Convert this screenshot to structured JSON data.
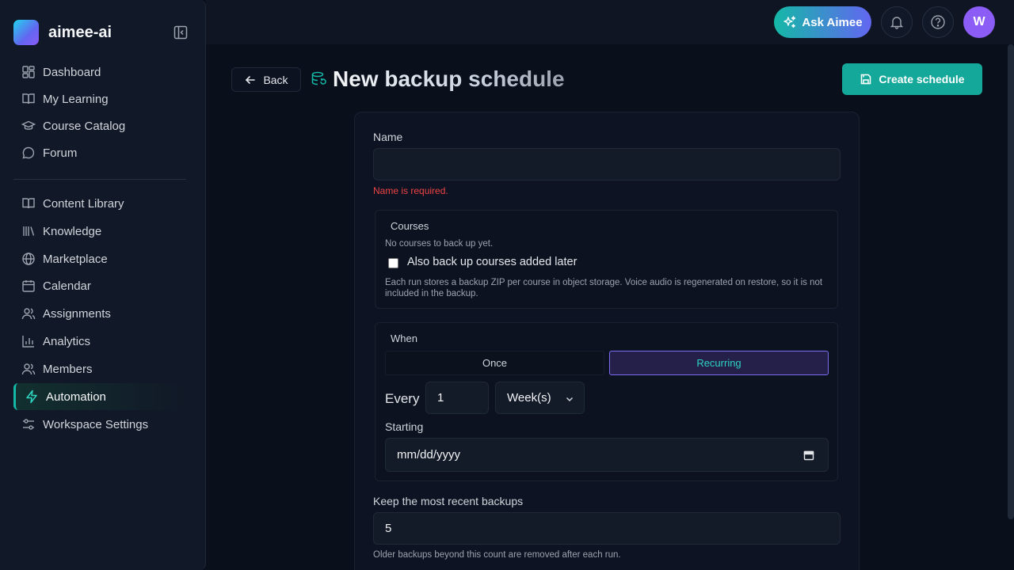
{
  "brand": {
    "name": "aimee-ai"
  },
  "sidebar": {
    "primary": [
      {
        "label": "Dashboard",
        "icon": "dashboard-icon"
      },
      {
        "label": "My Learning",
        "icon": "book-open-icon"
      },
      {
        "label": "Course Catalog",
        "icon": "graduation-cap-icon"
      },
      {
        "label": "Forum",
        "icon": "chat-bubble-icon"
      }
    ],
    "secondary": [
      {
        "label": "Content Library",
        "icon": "book-open-icon"
      },
      {
        "label": "Knowledge",
        "icon": "library-icon"
      },
      {
        "label": "Marketplace",
        "icon": "globe-icon"
      },
      {
        "label": "Calendar",
        "icon": "calendar-icon"
      },
      {
        "label": "Assignments",
        "icon": "users-icon"
      },
      {
        "label": "Analytics",
        "icon": "bar-chart-icon"
      },
      {
        "label": "Members",
        "icon": "users-icon"
      },
      {
        "label": "Automation",
        "icon": "lightning-icon",
        "active": true
      },
      {
        "label": "Workspace Settings",
        "icon": "sliders-icon"
      }
    ]
  },
  "topbar": {
    "ask_label": "Ask Aimee",
    "avatar_initial": "W"
  },
  "header": {
    "back_label": "Back",
    "title": "New backup schedule",
    "create_label": "Create schedule"
  },
  "form": {
    "name_label": "Name",
    "name_value": "",
    "name_error": "Name is required.",
    "courses": {
      "legend": "Courses",
      "empty_text": "No courses to back up yet.",
      "checkbox_label": "Also back up courses added later",
      "checkbox_checked": false,
      "help_text": "Each run stores a backup ZIP per course in object storage. Voice audio is regenerated on restore, so it is not included in the backup."
    },
    "when": {
      "legend": "When",
      "options": [
        "Once",
        "Recurring"
      ],
      "selected": "Recurring",
      "every_label": "Every",
      "every_value": "1",
      "unit_value": "Week(s)",
      "starting_label": "Starting",
      "date_placeholder": "mm/dd/yyyy"
    },
    "keep_label": "Keep the most recent backups",
    "keep_value": "5",
    "keep_help": "Older backups beyond this count are removed after each run."
  },
  "colors": {
    "accent": "#14b8a6",
    "brand_gradient_start": "#14b8a6",
    "brand_gradient_end": "#6366f1",
    "avatar": "#8b5cf6",
    "error": "#ef4444",
    "selected_border": "#7c6cf0"
  }
}
